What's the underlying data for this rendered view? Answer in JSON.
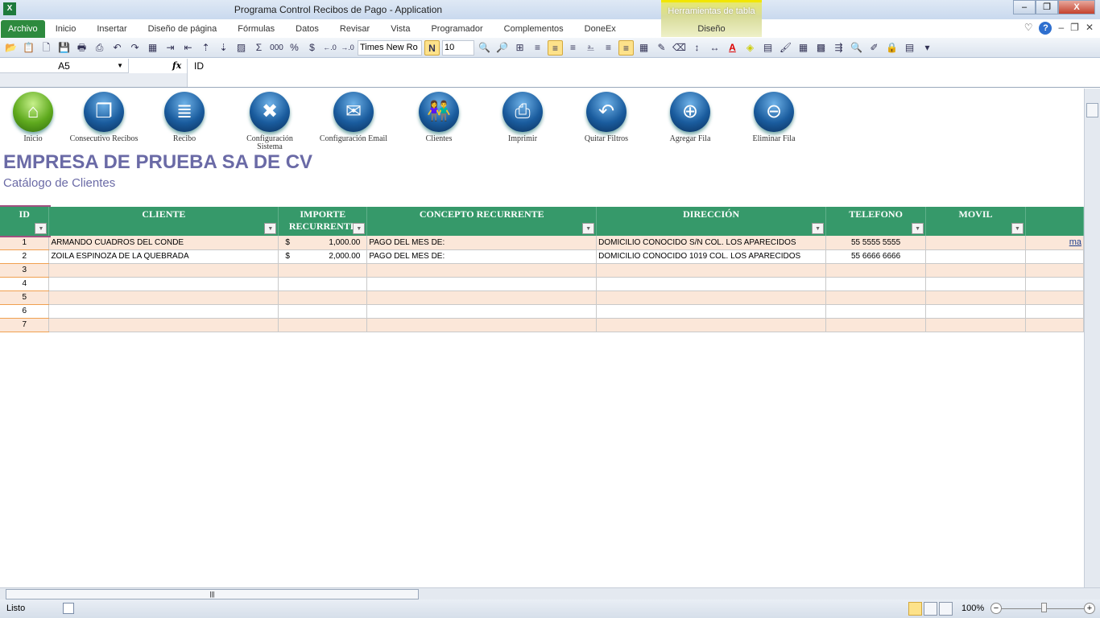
{
  "window": {
    "title": "Programa Control Recibos de Pago  -  Application",
    "icon": "X"
  },
  "ribbon": {
    "tabs": [
      "Archivo",
      "Inicio",
      "Insertar",
      "Diseño de página",
      "Fórmulas",
      "Datos",
      "Revisar",
      "Vista",
      "Programador",
      "Complementos",
      "DoneEx"
    ],
    "context_group": "Herramientas de tabla",
    "context_tab": "Diseño",
    "help": "?"
  },
  "toolbar": {
    "font_name": "Times New Ro",
    "bold": "N",
    "font_size": "10",
    "sum": "Σ",
    "thousands": "000",
    "percent": "%",
    "currency": "$"
  },
  "formula_bar": {
    "name_box": "A5",
    "fx": "fx",
    "value": "ID"
  },
  "nav_buttons": [
    {
      "label": "Inicio",
      "icon": "⌂"
    },
    {
      "label": "Consecutivo Recibos",
      "icon": "❐"
    },
    {
      "label": "Recibo",
      "icon": "≣"
    },
    {
      "label": "Configuración Sistema",
      "icon": "✖"
    },
    {
      "label": "Configuración Email",
      "icon": "✉"
    },
    {
      "label": "Clientes",
      "icon": "👫"
    },
    {
      "label": "Imprimir",
      "icon": "⎙"
    },
    {
      "label": "Quitar Filtros",
      "icon": "↶"
    },
    {
      "label": "Agregar Fila",
      "icon": "⊕"
    },
    {
      "label": "Eliminar Fila",
      "icon": "⊖"
    }
  ],
  "company": "EMPRESA DE PRUEBA SA DE CV",
  "subtitle": "Catálogo de Clientes",
  "table": {
    "headers": [
      "ID",
      "CLIENTE",
      "IMPORTE RECURRENTE",
      "CONCEPTO RECURRENTE",
      "DIRECCIÓN",
      "TELEFONO",
      "MOVIL",
      ""
    ],
    "rows": [
      {
        "id": "1",
        "cliente": "ARMANDO CUADROS DEL CONDE",
        "moneda": "$",
        "importe": "1,000.00",
        "concepto": "PAGO DEL MES DE:",
        "direccion": "DOMICILIO CONOCIDO S/N COL. LOS APARECIDOS",
        "telefono": "55 5555 5555",
        "movil": "",
        "extra": "ma"
      },
      {
        "id": "2",
        "cliente": "ZOILA ESPINOZA DE LA QUEBRADA",
        "moneda": "$",
        "importe": "2,000.00",
        "concepto": "PAGO DEL MES DE:",
        "direccion": "DOMICILIO CONOCIDO 1019 COL. LOS APARECIDOS",
        "telefono": "55 6666 6666",
        "movil": "",
        "extra": ""
      },
      {
        "id": "3"
      },
      {
        "id": "4"
      },
      {
        "id": "5"
      },
      {
        "id": "6"
      },
      {
        "id": "7"
      }
    ]
  },
  "status": {
    "ready": "Listo",
    "zoom": "100%"
  },
  "colors": {
    "header_green": "#36996a",
    "band": "#fbe7d9",
    "title": "#6a6aa6"
  }
}
